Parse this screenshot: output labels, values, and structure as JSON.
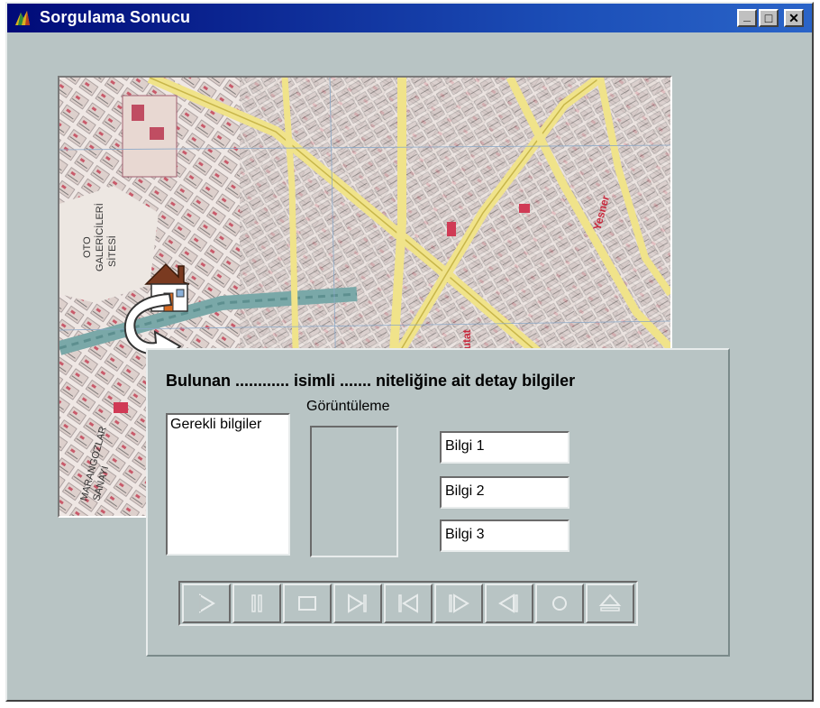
{
  "window": {
    "title": "Sorgulama Sonucu",
    "controls": {
      "minimize": "_",
      "maximize": "□",
      "close": "✕"
    }
  },
  "map": {
    "labels": [
      "OTO",
      "GALERİCİLERİ",
      "SİTESİ",
      "Yesner",
      "Kaykutat",
      "MARANGOZLAR",
      "SANAYİ"
    ]
  },
  "panel": {
    "heading": "Bulunan ............ isimli ....... niteliğine ait detay bilgiler",
    "list_title": "Gerekli bilgiler",
    "view_label": "Görüntüleme",
    "info_fields": [
      "Bilgi 1",
      "Bilgi 2",
      "Bilgi 3"
    ]
  },
  "media_buttons": [
    "play-icon",
    "pause-icon",
    "stop-icon",
    "next-icon",
    "previous-icon",
    "step-forward-icon",
    "step-back-icon",
    "record-icon",
    "eject-icon"
  ],
  "colors": {
    "titlebar": "#000a78",
    "background": "#b8c4c4"
  }
}
